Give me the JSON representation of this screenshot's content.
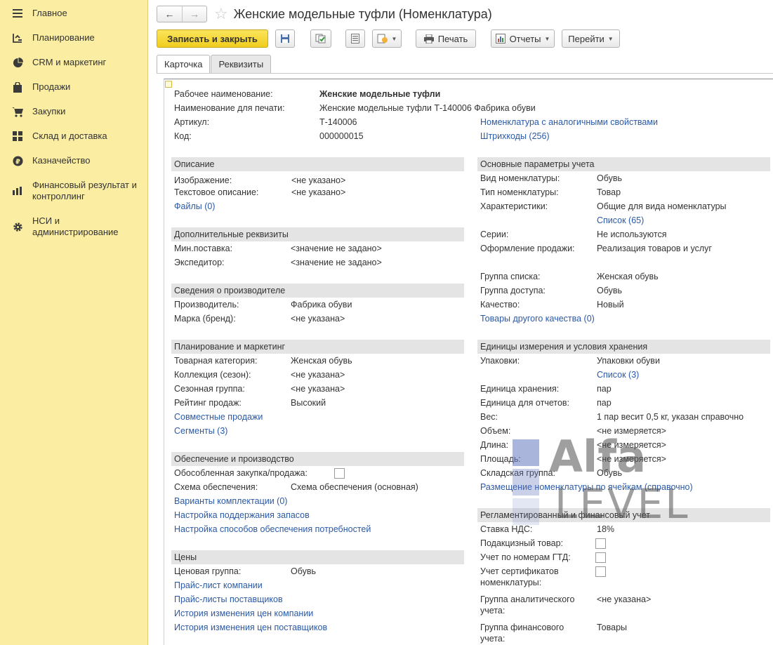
{
  "sidebar": {
    "items": [
      {
        "label": "Главное",
        "icon": "menu-icon"
      },
      {
        "label": "Планирование",
        "icon": "planning-icon"
      },
      {
        "label": "CRM и маркетинг",
        "icon": "pie-chart-icon"
      },
      {
        "label": "Продажи",
        "icon": "shopping-bag-icon"
      },
      {
        "label": "Закупки",
        "icon": "cart-icon"
      },
      {
        "label": "Склад и доставка",
        "icon": "warehouse-icon"
      },
      {
        "label": "Казначейство",
        "icon": "ruble-icon"
      },
      {
        "label": "Финансовый результат и контроллинг",
        "icon": "bar-chart-icon"
      },
      {
        "label": "НСИ и администрирование",
        "icon": "gear-icon"
      }
    ]
  },
  "header": {
    "back": "←",
    "forward": "→",
    "star": "☆",
    "title": "Женские модельные туфли (Номенклатура)"
  },
  "toolbar": {
    "save_close": "Записать и закрыть",
    "print": "Печать",
    "reports": "Отчеты",
    "goto": "Перейти"
  },
  "tabs": [
    "Карточка",
    "Реквизиты"
  ],
  "card": {
    "top": {
      "work_name_label": "Рабочее наименование:",
      "work_name": "Женские модельные туфли",
      "print_name_label": "Наименование для печати:",
      "print_name": "Женские модельные туфли Т-140006 Фабрика обуви",
      "article_label": "Артикул:",
      "article": "Т-140006",
      "code_label": "Код:",
      "code": "000000015",
      "similar_link": "Номенклатура с аналогичными свойствами",
      "barcodes_link": "Штрихкоды (256)"
    },
    "description": {
      "title": "Описание",
      "image_label": "Изображение:",
      "image": "<не указано>",
      "text_label": "Текстовое описание:",
      "text": "<не указано>",
      "files_link": "Файлы (0)"
    },
    "extra": {
      "title": "Дополнительные реквизиты",
      "min_label": "Мин.поставка:",
      "min": "<значение не задано>",
      "forwarder_label": "Экспедитор:",
      "forwarder": "<значение не задано>"
    },
    "manufacturer": {
      "title": "Сведения о производителе",
      "maker_label": "Производитель:",
      "maker": "Фабрика обуви",
      "brand_label": "Марка (бренд):",
      "brand": "<не указана>"
    },
    "planning": {
      "title": "Планирование и маркетинг",
      "category_label": "Товарная категория:",
      "category": "Женская обувь",
      "collection_label": "Коллекция (сезон):",
      "collection": "<не указана>",
      "season_label": "Сезонная группа:",
      "season": "<не указана>",
      "rating_label": "Рейтинг продаж:",
      "rating": "Высокий",
      "joint_link": "Совместные продажи",
      "segments_link": "Сегменты (3)"
    },
    "supply": {
      "title": "Обеспечение и производство",
      "separate_label": "Обособленная закупка/продажа:",
      "scheme_label": "Схема обеспечения:",
      "scheme": "Схема обеспечения (основная)",
      "kits_link": "Варианты комплектации (0)",
      "stock_link": "Настройка поддержания запасов",
      "methods_link": "Настройка способов обеспечения потребностей"
    },
    "prices": {
      "title": "Цены",
      "group_label": "Ценовая группа:",
      "group": "Обувь",
      "company_link": "Прайс-лист компании",
      "suppliers_link": "Прайс-листы поставщиков",
      "history_company_link": "История изменения цен компании",
      "history_suppliers_link": "История изменения цен поставщиков"
    },
    "params": {
      "title": "Основные параметры учета",
      "kind_label": "Вид номенклатуры:",
      "kind": "Обувь",
      "type_label": "Тип номенклатуры:",
      "type": "Товар",
      "chars_label": "Характеристики:",
      "chars": "Общие для вида номенклатуры",
      "chars_link": "Список (65)",
      "series_label": "Серии:",
      "series": "Не используются",
      "sale_label": "Оформление продажи:",
      "sale": "Реализация товаров и услуг",
      "list_group_label": "Группа списка:",
      "list_group": "Женская обувь",
      "access_label": "Группа доступа:",
      "access": "Обувь",
      "quality_label": "Качество:",
      "quality": "Новый",
      "other_quality_link": "Товары другого качества (0)"
    },
    "units": {
      "title": "Единицы измерения и условия хранения",
      "pack_label": "Упаковки:",
      "pack": "Упаковки обуви",
      "pack_link": "Список (3)",
      "storage_label": "Единица хранения:",
      "storage": "пар",
      "report_label": "Единица для отчетов:",
      "report": "пар",
      "weight_label": "Вес:",
      "weight": "1 пар весит 0,5 кг, указан справочно",
      "volume_label": "Объем:",
      "volume": "<не измеряется>",
      "length_label": "Длина:",
      "length": "<не измеряется>",
      "area_label": "Площадь:",
      "area": "<не измеряется>",
      "wh_group_label": "Складская группа:",
      "wh_group": "Обувь",
      "cells_link": "Размещение номенклатуры по ячейкам (справочно)"
    },
    "finance": {
      "title": "Регламентированный и финансовый учет",
      "vat_label": "Ставка НДС:",
      "vat": "18%",
      "excise_label": "Подакцизный товар:",
      "gtd_label": "Учет по номерам ГТД:",
      "cert_label_1": "Учет сертификатов",
      "cert_label_2": "номенклатуры:",
      "analytic_label_1": "Группа аналитического",
      "analytic_label_2": "учета:",
      "analytic": "<не указана>",
      "fin_label_1": "Группа финансового",
      "fin_label_2": "учета:",
      "fin": "Товары"
    }
  },
  "watermark": {
    "line1": "Alfa",
    "line2": "LEVEL"
  }
}
